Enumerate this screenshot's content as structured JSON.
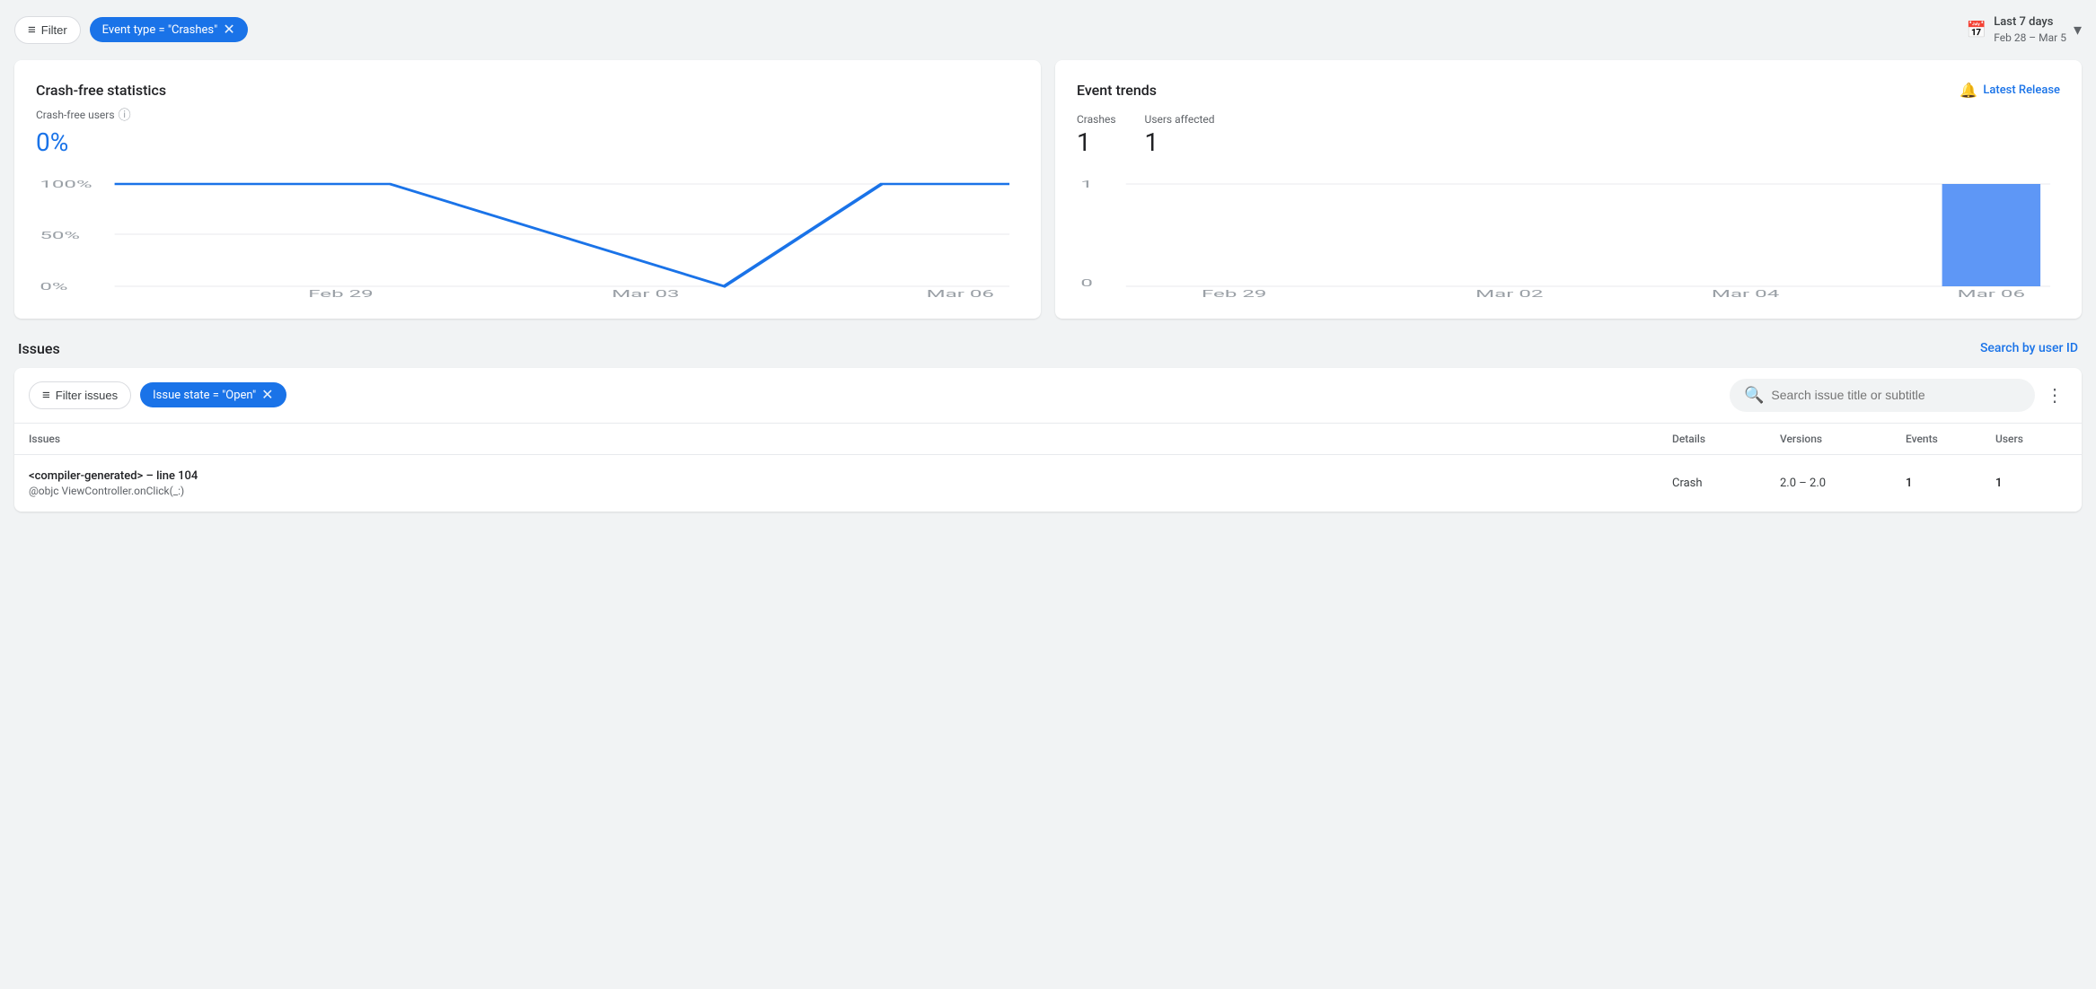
{
  "topbar": {
    "filter_label": "Filter",
    "event_type_chip": "Event type = \"Crashes\"",
    "date_label_line1": "Last 7 days",
    "date_label_line2": "Feb 28 – Mar 5"
  },
  "crash_free_card": {
    "title": "Crash-free statistics",
    "crash_free_label": "Crash-free users",
    "crash_free_value": "0%",
    "x_labels": [
      "Feb 29",
      "Mar 03",
      "Mar 06"
    ],
    "y_labels": [
      "100%",
      "50%",
      "0%"
    ]
  },
  "event_trends_card": {
    "title": "Event trends",
    "latest_release_label": "Latest Release",
    "crashes_label": "Crashes",
    "crashes_value": "1",
    "users_affected_label": "Users affected",
    "users_affected_value": "1",
    "x_labels": [
      "Feb 29",
      "Mar 02",
      "Mar 04",
      "Mar 06"
    ],
    "y_labels": [
      "1",
      "0"
    ]
  },
  "issues_section": {
    "title": "Issues",
    "search_by_user_label": "Search by user ID",
    "filter_issues_label": "Filter issues",
    "issue_state_chip": "Issue state = \"Open\"",
    "search_placeholder": "Search issue title or subtitle",
    "table_headers": {
      "issues": "Issues",
      "details": "Details",
      "versions": "Versions",
      "events": "Events",
      "users": "Users"
    },
    "rows": [
      {
        "title": "<compiler-generated> – line 104",
        "subtitle": "@objc ViewController.onClick(_:)",
        "details": "Crash",
        "versions": "2.0 – 2.0",
        "events": "1",
        "users": "1"
      }
    ]
  }
}
